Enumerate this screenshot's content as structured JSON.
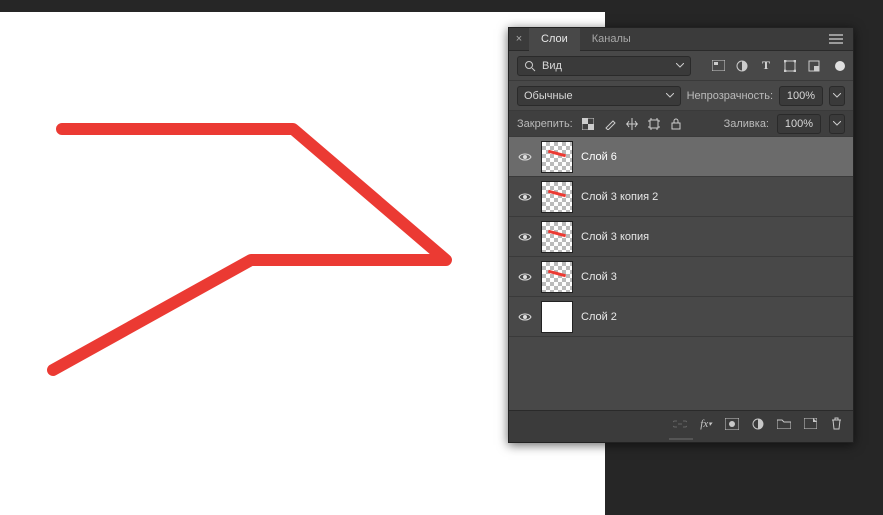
{
  "app": "Adobe Photoshop",
  "panel_title_close": "×",
  "tabs": [
    {
      "label": "Слои",
      "active": true
    },
    {
      "label": "Каналы",
      "active": false
    }
  ],
  "filter": {
    "label": "Вид"
  },
  "blend": {
    "mode_label": "Обычные"
  },
  "opacity": {
    "label": "Непрозрачность:",
    "value": "100%"
  },
  "lock": {
    "label": "Закрепить:"
  },
  "fill": {
    "label": "Заливка:",
    "value": "100%"
  },
  "layers": [
    {
      "name": "Слой 6",
      "selected": true,
      "thumb": "checker-stroke"
    },
    {
      "name": "Слой 3 копия 2",
      "selected": false,
      "thumb": "checker-stroke"
    },
    {
      "name": "Слой 3 копия",
      "selected": false,
      "thumb": "checker-stroke"
    },
    {
      "name": "Слой 3",
      "selected": false,
      "thumb": "checker-stroke"
    },
    {
      "name": "Слой 2",
      "selected": false,
      "thumb": "white"
    }
  ],
  "colors": {
    "stroke": "#eb3a33",
    "panel_bg": "#484848",
    "app_bg": "#262626"
  }
}
